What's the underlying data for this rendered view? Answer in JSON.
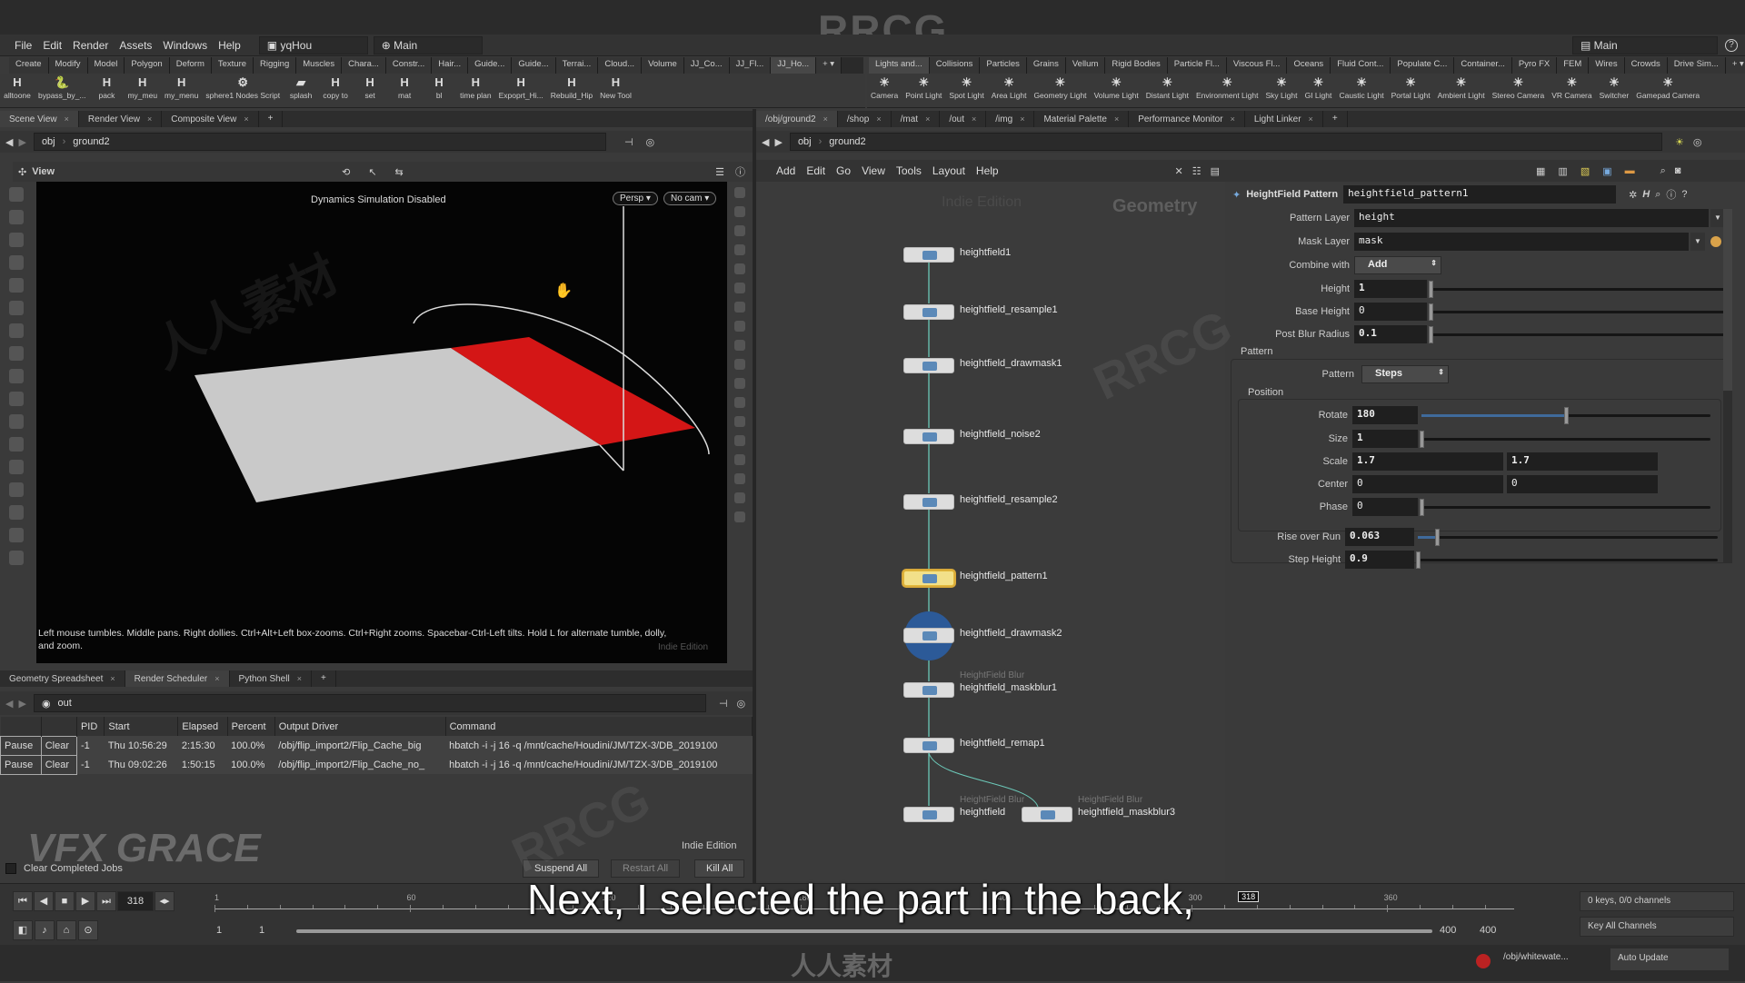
{
  "brand_watermark": "RRCG",
  "menubar": {
    "items": [
      "File",
      "Edit",
      "Render",
      "Assets",
      "Windows",
      "Help"
    ],
    "desktop": "yqHou",
    "context": "Main",
    "right_desktop": "Main",
    "help_icon": "question-icon"
  },
  "shelf_left": {
    "tabs": [
      "Create",
      "Modify",
      "Model",
      "Polygon",
      "Deform",
      "Texture",
      "Rigging",
      "Muscles",
      "Chara...",
      "Constr...",
      "Hair...",
      "Guide...",
      "Guide...",
      "Terrai...",
      "Cloud...",
      "Volume",
      "JJ_Co...",
      "JJ_Fl...",
      "JJ_Ho..."
    ],
    "active_tab": "JJ_Ho...",
    "tools": [
      "alltoone",
      "bypass_by_...",
      "pack",
      "my_meu",
      "my_menu",
      "sphere1 Nodes Script",
      "splash",
      "copy to",
      "set",
      "mat",
      "bl",
      "time plan",
      "Expoprt_Hi...",
      "Rebuild_Hip",
      "New Tool"
    ]
  },
  "shelf_right": {
    "tabs": [
      "Lights and...",
      "Collisions",
      "Particles",
      "Grains",
      "Vellum",
      "Rigid Bodies",
      "Particle Fl...",
      "Viscous Fl...",
      "Oceans",
      "Fluid Cont...",
      "Populate C...",
      "Container...",
      "Pyro FX",
      "FEM",
      "Wires",
      "Crowds",
      "Drive Sim..."
    ],
    "active_tab": "Lights and...",
    "tools": [
      "Camera",
      "Point Light",
      "Spot Light",
      "Area Light",
      "Geometry Light",
      "Volume Light",
      "Distant Light",
      "Environment Light",
      "Sky Light",
      "GI Light",
      "Caustic Light",
      "Portal Light",
      "Ambient Light",
      "Stereo Camera",
      "VR Camera",
      "Switcher",
      "Gamepad Camera"
    ]
  },
  "left_pane": {
    "tabs": [
      "Scene View",
      "Render View",
      "Composite View"
    ],
    "active_tab": "Scene View",
    "path": [
      "obj",
      "ground2"
    ],
    "view_label": "View",
    "viewport_message": "Dynamics Simulation Disabled",
    "persp_button": "Persp",
    "cam_button": "No cam",
    "help_text": "Left mouse tumbles. Middle pans. Right dollies. Ctrl+Alt+Left box-zooms. Ctrl+Right zooms. Spacebar-Ctrl-Left tilts. Hold L for alternate tumble, dolly, and zoom.",
    "edition": "Indie Edition",
    "terrain_colors": {
      "surface": "#c9c9c9",
      "selected": "#d41616"
    }
  },
  "bottom_pane": {
    "tabs": [
      "Geometry Spreadsheet",
      "Render Scheduler",
      "Python Shell"
    ],
    "active_tab": "Render Scheduler",
    "path": "out",
    "columns": [
      "",
      "",
      "PID",
      "Start",
      "Elapsed",
      "Percent",
      "Output Driver",
      "Command"
    ],
    "jobs": [
      {
        "pause": "Pause",
        "clear": "Clear",
        "pid": "-1",
        "start": "Thu 10:56:29",
        "elapsed": "2:15:30",
        "percent": "100.0%",
        "driver": "/obj/flip_import2/Flip_Cache_big",
        "command": "hbatch -i -j 16 -q /mnt/cache/Houdini/JM/TZX-3/DB_2019100"
      },
      {
        "pause": "Pause",
        "clear": "Clear",
        "pid": "-1",
        "start": "Thu 09:02:26",
        "elapsed": "1:50:15",
        "percent": "100.0%",
        "driver": "/obj/flip_import2/Flip_Cache_no_",
        "command": "hbatch -i -j 16 -q /mnt/cache/Houdini/JM/TZX-3/DB_2019100"
      }
    ],
    "edition": "Indie Edition",
    "clear_completed": "Clear Completed Jobs",
    "suspend_all": "Suspend All",
    "restart_all": "Restart All",
    "kill_all": "Kill All",
    "logo": "VFX GRACE"
  },
  "network": {
    "tabs": [
      "/obj/ground2",
      "/shop",
      "/mat",
      "/out",
      "/img",
      "Material Palette",
      "Performance Monitor",
      "Light Linker"
    ],
    "active_tab": "/obj/ground2",
    "path": [
      "obj",
      "ground2"
    ],
    "menu": [
      "Add",
      "Edit",
      "Go",
      "View",
      "Tools",
      "Layout",
      "Help"
    ],
    "edition": "Indie Edition",
    "context": "Geometry",
    "nodes": [
      {
        "name": "heightfield1",
        "type": ""
      },
      {
        "name": "heightfield_resample1",
        "type": ""
      },
      {
        "name": "heightfield_drawmask1",
        "type": ""
      },
      {
        "name": "heightfield_noise2",
        "type": ""
      },
      {
        "name": "heightfield_resample2",
        "type": ""
      },
      {
        "name": "heightfield_pattern1",
        "type": "",
        "selected": true
      },
      {
        "name": "heightfield_drawmask2",
        "type": "",
        "current": true
      },
      {
        "name": "heightfield_maskblur1",
        "type": "HeightField Blur"
      },
      {
        "name": "heightfield_remap1",
        "type": ""
      },
      {
        "name": "heightfield",
        "type": "HeightField Blur"
      },
      {
        "name": "heightfield_maskblur3",
        "type": "HeightField Blur"
      }
    ]
  },
  "params": {
    "node_type": "HeightField Pattern",
    "node_name": "heightfield_pattern1",
    "pattern_layer_label": "Pattern Layer",
    "pattern_layer": "height",
    "mask_layer_label": "Mask Layer",
    "mask_layer": "mask",
    "combine_label": "Combine with",
    "combine": "Add",
    "height_label": "Height",
    "height": "1",
    "base_height_label": "Base Height",
    "base_height": "0",
    "post_blur_label": "Post Blur Radius",
    "post_blur": "0.1",
    "pattern_group": "Pattern",
    "pattern_label": "Pattern",
    "pattern": "Steps",
    "position_group": "Position",
    "rotate_label": "Rotate",
    "rotate": "180",
    "rotate_slider": 0.5,
    "size_label": "Size",
    "size": "1",
    "scale_label": "Scale",
    "scale_x": "1.7",
    "scale_y": "1.7",
    "center_label": "Center",
    "center_x": "0",
    "center_y": "0",
    "phase_label": "Phase",
    "phase": "0",
    "rise_label": "Rise over Run",
    "rise": "0.063",
    "rise_slider": 0.063,
    "step_label": "Step Height",
    "step": "0.9"
  },
  "timeline": {
    "current_frame": "318",
    "ticks": [
      "1",
      "60",
      "120",
      "180",
      "240",
      "300",
      "360"
    ],
    "range_start": "1",
    "range_start2": "1",
    "range_end": "400",
    "range_end2": "400",
    "keys_info": "0 keys, 0/0 channels",
    "key_all": "Key All Channels"
  },
  "statusbar": {
    "path": "/obj/whitewate...",
    "auto_update": "Auto Update",
    "watermark": "人人素材"
  },
  "subtitle": "Next, I selected the part in the back,"
}
